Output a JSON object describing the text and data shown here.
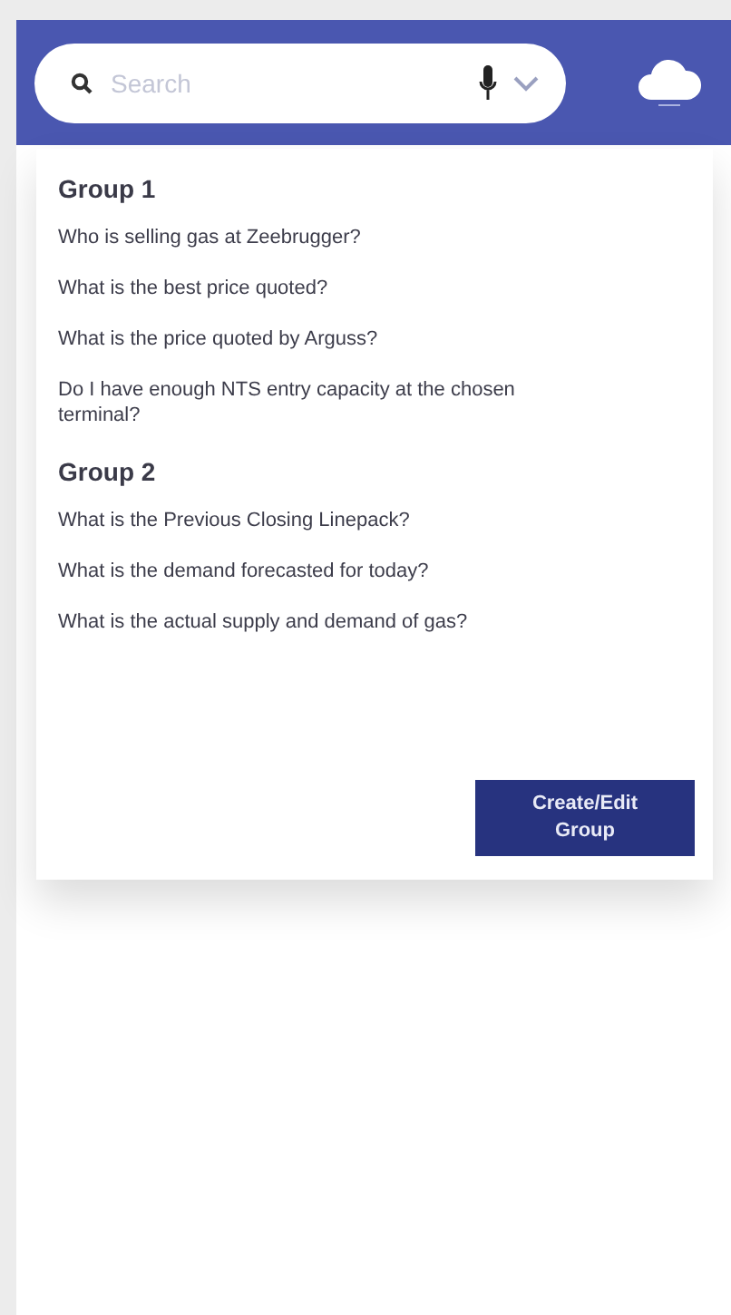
{
  "search": {
    "placeholder": "Search"
  },
  "groups": [
    {
      "title": "Group 1",
      "questions": [
        "Who is selling gas at Zeebrugger?",
        "What is the best price quoted?",
        "What is the price quoted by Arguss?",
        "Do I have enough NTS entry capacity at the chosen terminal?"
      ]
    },
    {
      "title": "Group 2",
      "questions": [
        "What is the Previous Closing Linepack?",
        "What is the demand forecasted for today?",
        "What is the actual supply and demand of gas?"
      ]
    }
  ],
  "button": "Create/Edit Group"
}
